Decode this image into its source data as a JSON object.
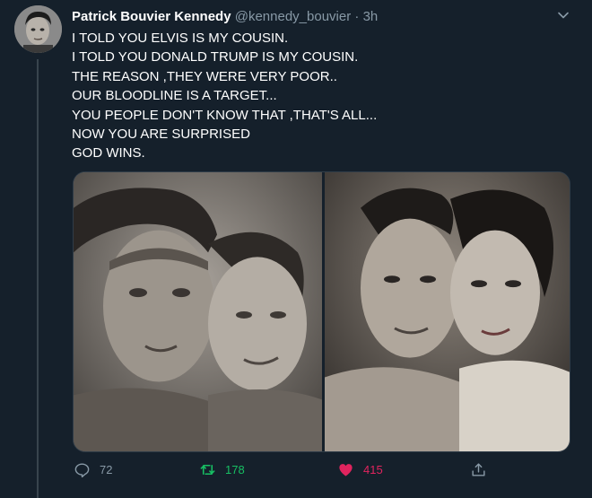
{
  "tweet": {
    "display_name": "Patrick Bouvier Kennedy",
    "handle": "@kennedy_bouvier",
    "separator": "·",
    "time": "3h",
    "lines": [
      "I TOLD YOU ELVIS IS MY COUSIN.",
      "I TOLD YOU DONALD TRUMP IS MY COUSIN.",
      "THE REASON ,THEY WERE VERY POOR..",
      "OUR BLOODLINE IS A TARGET...",
      "YOU PEOPLE DON'T KNOW THAT ,THAT'S ALL...",
      "NOW YOU ARE SURPRISED",
      "GOD WINS."
    ]
  },
  "actions": {
    "reply_count": "72",
    "retweet_count": "178",
    "like_count": "415"
  },
  "colors": {
    "background": "#15202b",
    "muted": "#8899a6",
    "retweet": "#17bf63",
    "like": "#e0245e"
  },
  "icons": {
    "reply": "reply-icon",
    "retweet": "retweet-icon",
    "like": "heart-icon",
    "share": "share-icon",
    "menu": "chevron-down-icon"
  }
}
